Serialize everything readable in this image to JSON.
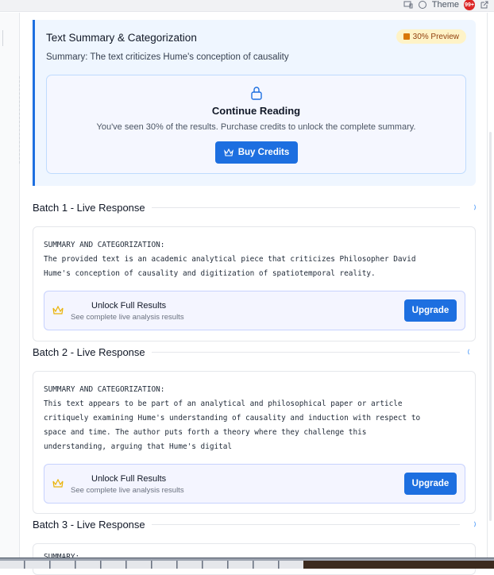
{
  "topbar": {
    "theme_label": "Theme",
    "notif_count": "99+"
  },
  "preview": {
    "title": "Text Summary & Categorization",
    "badge": "30% Preview",
    "summary": "Summary: The text criticizes Hume's conception of causality",
    "continue_title": "Continue Reading",
    "continue_text": "You've seen 30% of the results. Purchase credits to unlock the complete summary.",
    "buy_label": "Buy Credits"
  },
  "batches": [
    {
      "title": "Batch 1 - Live Response",
      "text": "SUMMARY AND CATEGORIZATION:\nThe provided text is an academic analytical piece that criticizes Philosopher David\nHume's conception of causality and digitization of spatiotemporal reality.",
      "unlock_title": "Unlock Full Results",
      "unlock_sub": "See complete live analysis results",
      "upgrade_label": "Upgrade"
    },
    {
      "title": "Batch 2 - Live Response",
      "text": "SUMMARY AND CATEGORIZATION:\nThis text appears to be part of an analytical and philosophical paper or article\ncritiquely examining Hume's understanding of causality and induction with respect to\nspace and time. The author puts forth a theory where they challenge this\nunderstanding, arguing that Hume's digital",
      "unlock_title": "Unlock Full Results",
      "unlock_sub": "See complete live analysis results",
      "upgrade_label": "Upgrade"
    },
    {
      "title": "Batch 3 - Live Response",
      "text": "SUMMARY:"
    }
  ],
  "colors": {
    "accent": "#1d6fe0",
    "badge_bg": "#fef3c7",
    "preview_bg": "#eff6ff",
    "crown": "#eab308"
  }
}
